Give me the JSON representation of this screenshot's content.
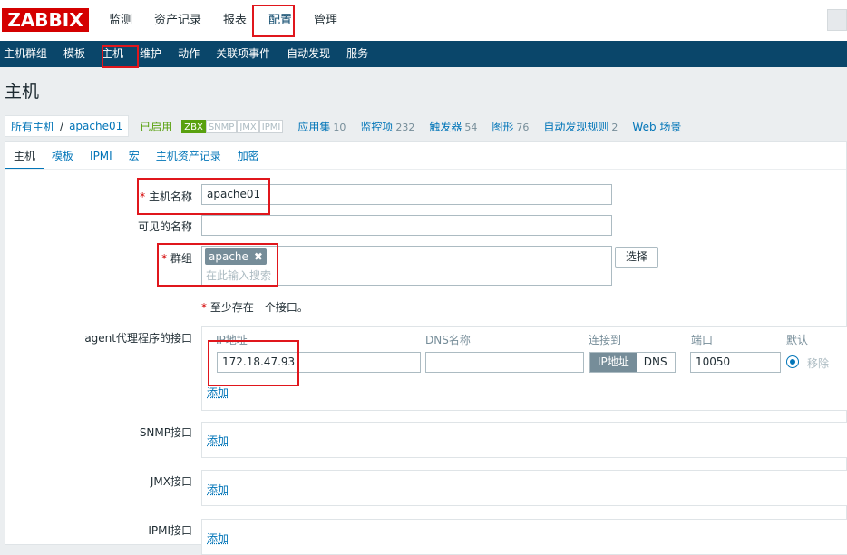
{
  "brand": {
    "logo": "ZABBIX"
  },
  "main_nav": [
    "监测",
    "资产记录",
    "报表",
    "配置",
    "管理"
  ],
  "sub_nav": [
    "主机群组",
    "模板",
    "主机",
    "维护",
    "动作",
    "关联项事件",
    "自动发现",
    "服务"
  ],
  "page": {
    "title": "主机"
  },
  "breadcrumb": {
    "root": "所有主机",
    "sep": "/",
    "current": "apache01",
    "status": "已启用"
  },
  "availability": [
    "ZBX",
    "SNMP",
    "JMX",
    "IPMI"
  ],
  "stats": [
    {
      "label": "应用集",
      "count": "10"
    },
    {
      "label": "监控项",
      "count": "232"
    },
    {
      "label": "触发器",
      "count": "54"
    },
    {
      "label": "图形",
      "count": "76"
    },
    {
      "label": "自动发现规则",
      "count": "2"
    },
    {
      "label": "Web 场景",
      "count": ""
    }
  ],
  "tabs": [
    "主机",
    "模板",
    "IPMI",
    "宏",
    "主机资产记录",
    "加密"
  ],
  "form": {
    "req_mark": "*",
    "host_name_label": "主机名称",
    "host_name_value": "apache01",
    "visible_name_label": "可见的名称",
    "visible_name_value": "",
    "groups_label": "群组",
    "group_tag": "apache",
    "group_remove": "✖",
    "groups_placeholder": "在此输入搜索",
    "select_button": "选择",
    "note": "至少存在一个接口。",
    "agent_label": "agent代理程序的接口",
    "snmp_label": "SNMP接口",
    "jmx_label": "JMX接口",
    "ipmi_label": "IPMI接口",
    "add_link": "添加"
  },
  "interface": {
    "headers": {
      "ip": "IP地址",
      "dns": "DNS名称",
      "connect": "连接到",
      "port": "端口",
      "default": "默认"
    },
    "ip_value": "172.18.47.93",
    "dns_value": "",
    "connect_ip": "IP地址",
    "connect_dns": "DNS",
    "port_value": "10050",
    "remove": "移除"
  },
  "colors": {
    "brand_red": "#d40000",
    "nav_blue": "#0a466a",
    "link_blue": "#0275b8",
    "enabled_green": "#59a10f",
    "highlight_red": "#e0161c"
  }
}
